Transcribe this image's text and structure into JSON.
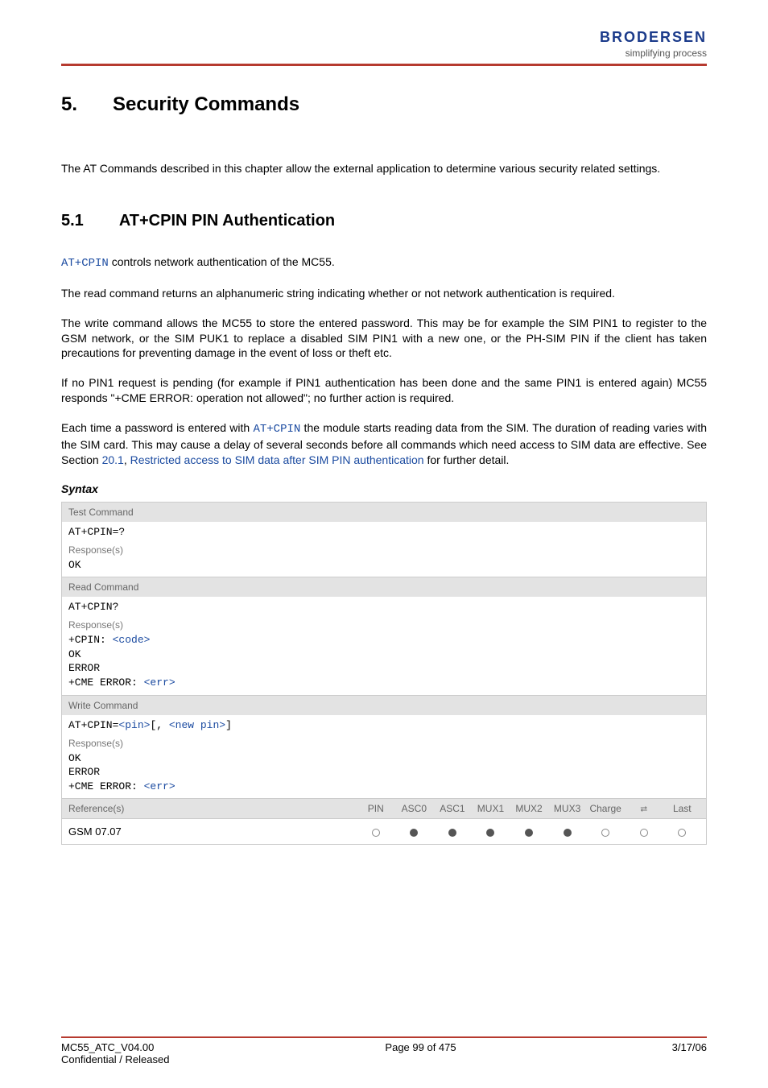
{
  "brand": {
    "name": "BRODERSEN",
    "tagline": "simplifying process"
  },
  "chapter": {
    "num": "5.",
    "title": "Security Commands"
  },
  "intro": "The AT Commands described in this chapter allow the external application to determine various security related settings.",
  "section": {
    "num": "5.1",
    "title": "AT+CPIN   PIN Authentication"
  },
  "body": {
    "p1a": "AT+CPIN",
    "p1b": " controls network authentication of the MC55.",
    "p2": "The read command returns an alphanumeric string indicating whether or not network authentication is required.",
    "p3": "The write command allows the MC55 to store the entered password. This may be for example the SIM PIN1 to register to the GSM network, or the SIM PUK1 to replace a disabled SIM PIN1 with a new one, or the PH-SIM PIN if the client has taken precautions for preventing damage in the event of loss or theft etc.",
    "p4": "If no PIN1 request is pending (for example if PIN1 authentication has been done and the same PIN1 is entered again) MC55 responds \"+CME ERROR: operation not allowed\"; no further action is required.",
    "p5a": "Each time a password is entered with ",
    "p5b": "AT+CPIN",
    "p5c": " the module starts reading data from the SIM. The duration of reading varies with the SIM card. This may cause a delay of several seconds before all commands which need access to SIM data are effective. See Section ",
    "p5d": "20.1",
    "p5e": ", ",
    "p5f": "Restricted access to SIM data after SIM PIN authentication",
    "p5g": " for further detail."
  },
  "syntax_label": "Syntax",
  "blocks": {
    "test": {
      "hdr": "Test Command",
      "cmd": "AT+CPIN=?",
      "resp_label": "Response(s)",
      "resp": "OK"
    },
    "read": {
      "hdr": "Read Command",
      "cmd": "AT+CPIN?",
      "resp_label": "Response(s)",
      "resp_prefix": "+CPIN: ",
      "resp_code": "<code>",
      "resp_ok": "OK",
      "resp_err": "ERROR",
      "resp_cme_prefix": "+CME ERROR: ",
      "resp_cme_err": "<err>"
    },
    "write": {
      "hdr": "Write Command",
      "cmd_prefix": "AT+CPIN=",
      "cmd_pin": "<pin>",
      "cmd_mid": "[, ",
      "cmd_newpin": "<new pin>",
      "cmd_end": "]",
      "resp_label": "Response(s)",
      "resp_ok": "OK",
      "resp_err": "ERROR",
      "resp_cme_prefix": "+CME ERROR: ",
      "resp_cme_err": "<err>"
    }
  },
  "ref": {
    "label": "Reference(s)",
    "value": "GSM 07.07",
    "cols": [
      "PIN",
      "ASC0",
      "ASC1",
      "MUX1",
      "MUX2",
      "MUX3",
      "Charge",
      "⇄",
      "Last"
    ],
    "states": [
      "empty",
      "filled",
      "filled",
      "filled",
      "filled",
      "filled",
      "empty",
      "empty",
      "empty"
    ]
  },
  "footer": {
    "left1": "MC55_ATC_V04.00",
    "left2": "Confidential / Released",
    "center": "Page 99 of 475",
    "right": "3/17/06"
  }
}
